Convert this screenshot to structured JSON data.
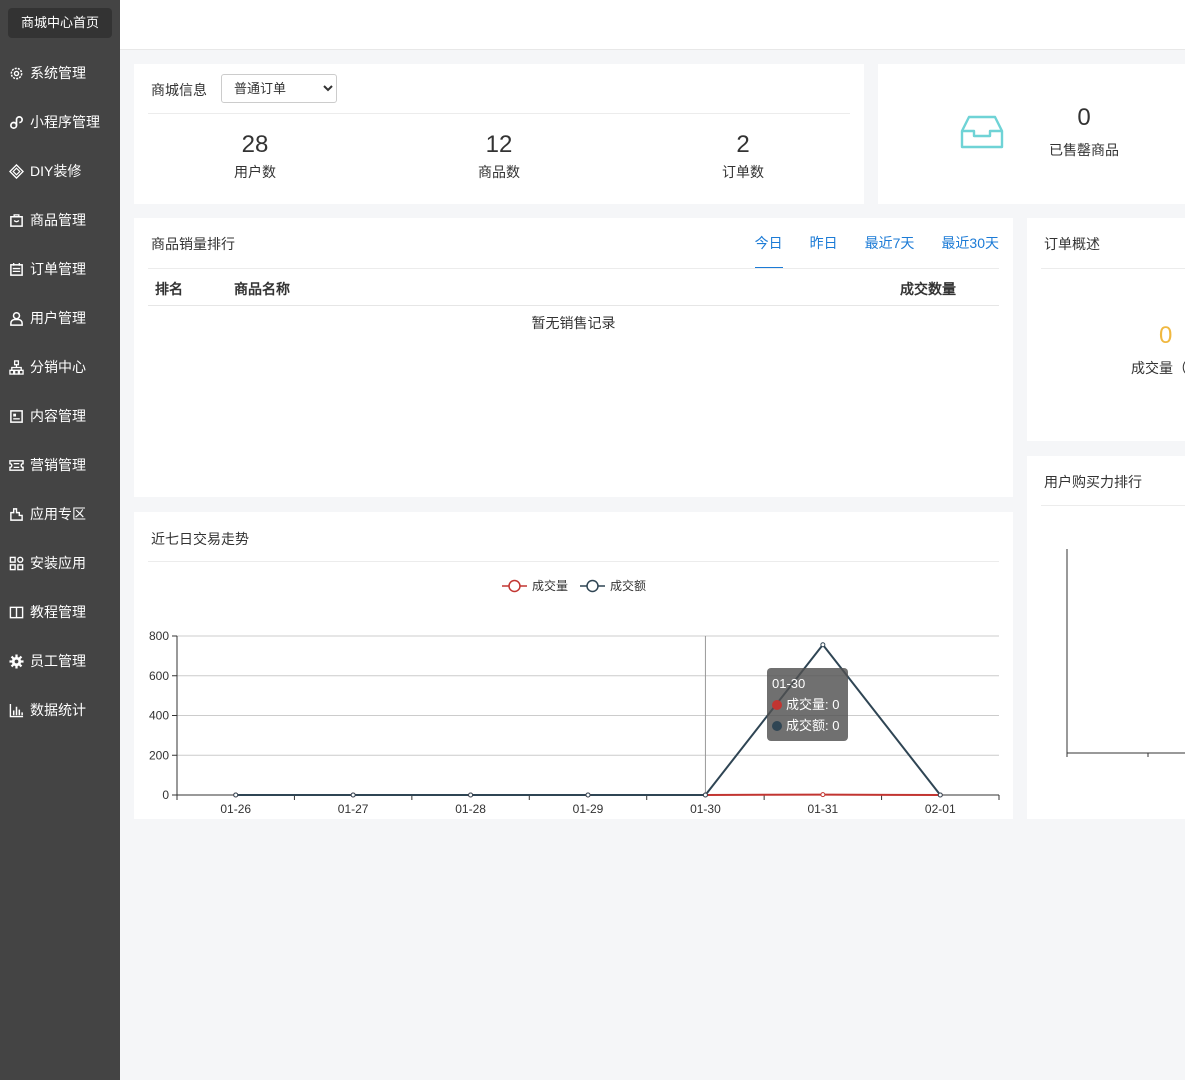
{
  "sidebar": {
    "home": "商城中心首页",
    "items": [
      {
        "label": "系统管理",
        "icon": "gear-outline-icon"
      },
      {
        "label": "小程序管理",
        "icon": "link-icon"
      },
      {
        "label": "DIY装修",
        "icon": "diamond-icon"
      },
      {
        "label": "商品管理",
        "icon": "bag-icon"
      },
      {
        "label": "订单管理",
        "icon": "calendar-icon"
      },
      {
        "label": "用户管理",
        "icon": "user-icon"
      },
      {
        "label": "分销中心",
        "icon": "org-chart-icon"
      },
      {
        "label": "内容管理",
        "icon": "article-icon"
      },
      {
        "label": "营销管理",
        "icon": "ticket-icon"
      },
      {
        "label": "应用专区",
        "icon": "app-zone-icon"
      },
      {
        "label": "安装应用",
        "icon": "grid-icon"
      },
      {
        "label": "教程管理",
        "icon": "book-icon"
      },
      {
        "label": "员工管理",
        "icon": "gear-solid-icon"
      },
      {
        "label": "数据统计",
        "icon": "bar-chart-icon"
      }
    ]
  },
  "stats": {
    "title": "商城信息",
    "select_value": "普通订单",
    "items": [
      {
        "value": "28",
        "label": "用户数"
      },
      {
        "value": "12",
        "label": "商品数"
      },
      {
        "value": "2",
        "label": "订单数"
      }
    ]
  },
  "sold_out": {
    "value": "0",
    "label": "已售罄商品",
    "icon": "inbox-icon"
  },
  "ranking": {
    "title": "商品销量排行",
    "tabs": [
      "今日",
      "昨日",
      "最近7天",
      "最近30天"
    ],
    "active_tab": "今日",
    "columns": [
      "排名",
      "商品名称",
      "成交数量"
    ],
    "empty_text": "暂无销售记录"
  },
  "order_overview": {
    "title": "订单概述",
    "value": "0",
    "label": "成交量（"
  },
  "buy_rank": {
    "title": "用户购买力排行"
  },
  "trend": {
    "title": "近七日交易走势",
    "tooltip": {
      "title": "01-30",
      "lines": [
        "成交量: 0",
        "成交额: 0"
      ]
    }
  },
  "chart_data": {
    "type": "line",
    "x": [
      "01-26",
      "01-27",
      "01-28",
      "01-29",
      "01-30",
      "01-31",
      "02-01"
    ],
    "series": [
      {
        "name": "成交量",
        "values": [
          0,
          0,
          0,
          0,
          0,
          2,
          0
        ],
        "color": "#c23531"
      },
      {
        "name": "成交额",
        "values": [
          0,
          0,
          0,
          0,
          0,
          756,
          0
        ],
        "color": "#2f4554"
      }
    ],
    "yticks": [
      0,
      200,
      400,
      600,
      800
    ],
    "ylim": [
      0,
      800
    ],
    "legend": "top-center",
    "grid": true
  }
}
